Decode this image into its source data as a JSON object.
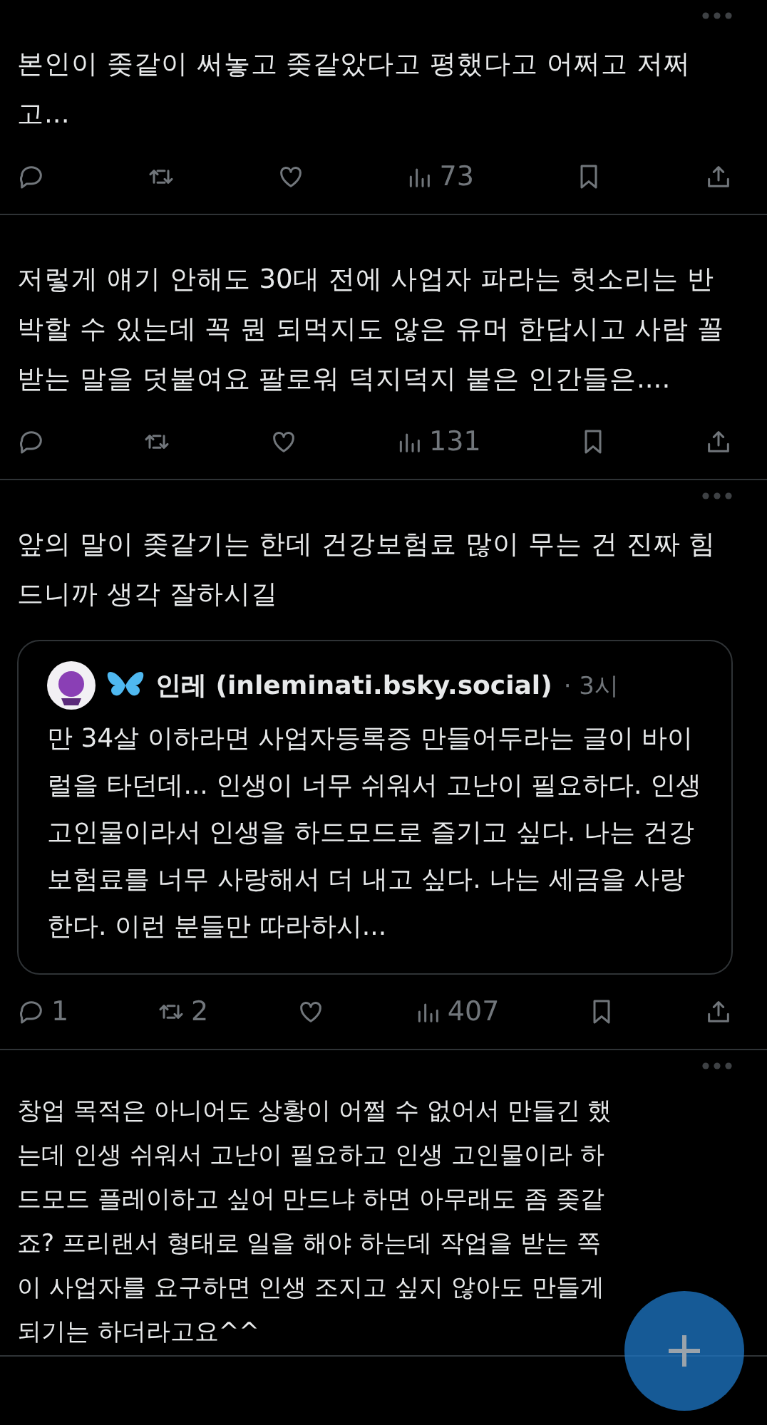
{
  "posts": [
    {
      "more": true,
      "text": "본인이 좆같이 써놓고 좆같았다고 평했다고 어쩌고 저쩌고...",
      "actions": {
        "views": "73"
      }
    },
    {
      "more": false,
      "text": "저렇게 얘기 안해도 30대 전에 사업자 파라는 헛소리는 반박할 수 있는데 꼭 뭔 되먹지도 않은 유머 한답시고 사람 꼴받는 말을 덧붙여요 팔로워 덕지덕지 붙은 인간들은....",
      "actions": {
        "views": "131"
      }
    },
    {
      "more": true,
      "text": "앞의 말이 좆같기는 한데 건강보험료 많이 무는 건 진짜 힘드니까 생각 잘하시길",
      "quote": {
        "author": "인레 (inleminati.bsky.social)",
        "time": "· 3시",
        "text": "만 34살 이하라면 사업자등록증 만들어두라는 글이 바이럴을 타던데... 인생이 너무 쉬워서 고난이 필요하다. 인생 고인물이라서 인생을 하드모드로 즐기고 싶다. 나는 건강보험료를 너무 사랑해서 더 내고 싶다. 나는 세금을 사랑한다. 이런 분들만 따라하시..."
      },
      "actions": {
        "replies": "1",
        "reposts": "2",
        "views": "407"
      }
    },
    {
      "more": true,
      "text": "창업 목적은 아니어도 상황이 어쩔 수 없어서 만들긴 했는데 인생 쉬워서 고난이 필요하고 인생 고인물이라 하드모드 플레이하고 싶어 만드냐 하면 아무래도 좀 좆같죠? 프리랜서 형태로 일을 해야 하는데 작업을 받는 쪽이 사업자를 요구하면 인생 조지고 싶지 않아도 만들게 되기는 하더라고요^^"
    }
  ]
}
